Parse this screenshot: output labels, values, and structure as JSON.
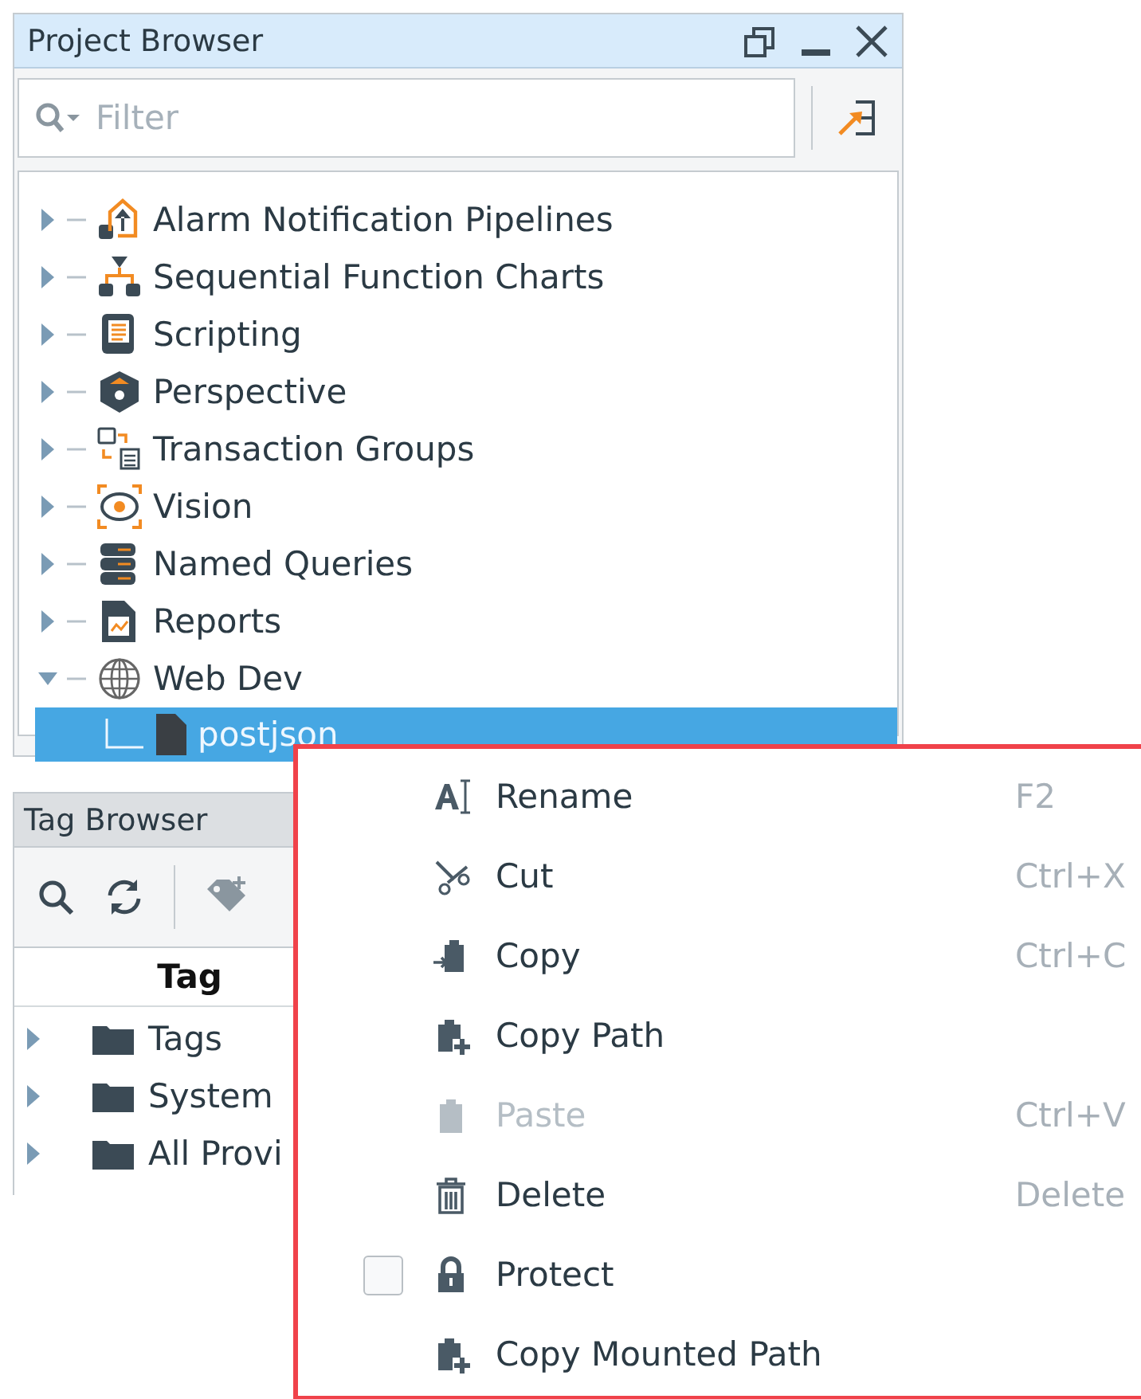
{
  "project_browser": {
    "title": "Project Browser",
    "filter": {
      "placeholder": "Filter"
    },
    "tree": [
      {
        "label": "Alarm Notification Pipelines",
        "expanded": false
      },
      {
        "label": "Sequential Function Charts",
        "expanded": false
      },
      {
        "label": "Scripting",
        "expanded": false
      },
      {
        "label": "Perspective",
        "expanded": false
      },
      {
        "label": "Transaction Groups",
        "expanded": false
      },
      {
        "label": "Vision",
        "expanded": false
      },
      {
        "label": "Named Queries",
        "expanded": false
      },
      {
        "label": "Reports",
        "expanded": false
      },
      {
        "label": "Web Dev",
        "expanded": true,
        "children": [
          {
            "label": "postjson",
            "selected": true
          }
        ]
      }
    ]
  },
  "tag_browser": {
    "title": "Tag Browser",
    "column": "Tag",
    "rows": [
      {
        "label": "Tags",
        "expanded": false
      },
      {
        "label": "System",
        "expanded": false
      },
      {
        "label": "All Provi",
        "expanded": false
      }
    ]
  },
  "context_menu": [
    {
      "kind": "action",
      "label": "Rename",
      "shortcut": "F2",
      "disabled": false
    },
    {
      "kind": "action",
      "label": "Cut",
      "shortcut": "Ctrl+X",
      "disabled": false
    },
    {
      "kind": "action",
      "label": "Copy",
      "shortcut": "Ctrl+C",
      "disabled": false
    },
    {
      "kind": "action",
      "label": "Copy Path",
      "disabled": false
    },
    {
      "kind": "action",
      "label": "Paste",
      "shortcut": "Ctrl+V",
      "disabled": true
    },
    {
      "kind": "action",
      "label": "Delete",
      "shortcut": "Delete",
      "disabled": false
    },
    {
      "kind": "checkbox",
      "label": "Protect",
      "checked": false,
      "disabled": false
    },
    {
      "kind": "action",
      "label": "Copy Mounted Path",
      "disabled": false
    }
  ]
}
